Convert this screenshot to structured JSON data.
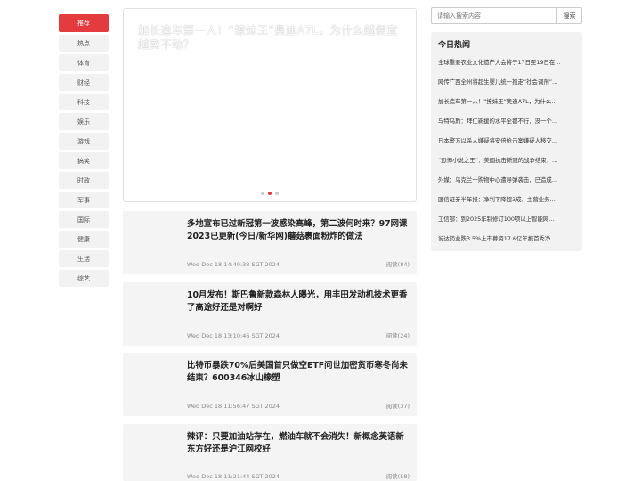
{
  "nav": {
    "items": [
      "推荐",
      "热点",
      "体育",
      "财经",
      "科技",
      "娱乐",
      "游戏",
      "搞笑",
      "时政",
      "军事",
      "国际",
      "健康",
      "生活",
      "综艺"
    ]
  },
  "carousel": {
    "caption": "加长造车第一人！“撩妹王”奥迪A7L，为什么越便宜越卖不动？",
    "active_slide": 2,
    "slide_count": 3
  },
  "articles": [
    {
      "title": "多地宣布已过新冠第一波感染高峰，第二波何时来？97网课2023已更新(今日/新华网)蘑菇裹面粉炸的做法",
      "date": "Wed Dec 18 14:49:38 SGT 2024",
      "reads": "阅读(84)"
    },
    {
      "title": "10月发布！斯巴鲁新款森林人曝光，用丰田发动机技术更香了高途好还是对啊好",
      "date": "Wed Dec 18 13:10:46 SGT 2024",
      "reads": "阅读(24)"
    },
    {
      "title": "比特币暴跌70%后美国首只做空ETF问世加密货币寒冬尚未结束？600346冰山橡塑",
      "date": "Wed Dec 18 11:56:47 SGT 2024",
      "reads": "阅读(37)"
    },
    {
      "title": "辣评：只要加油站存在，燃油车就不会消失！新概念英语新东方好还是沪江网校好",
      "date": "Wed Dec 18 11:21:44 SGT 2024",
      "reads": "阅读(58)"
    }
  ],
  "search": {
    "placeholder": "请输入搜索内容",
    "value": "",
    "button_label": "搜索"
  },
  "hot": {
    "title": "今日热闻",
    "items": [
      "全球重要农业文化遗产大会将于17日至19日在…",
      "网传广西全州将超生婴儿统一抱走“社会调剂”…",
      "加长造车第一人！“撩妹王”奥迪A7L，为什么…",
      "马特乌斯：拜仁新援的水平全都不行，没一个…",
      "日本警方以杀人嫌疑将安倍枪击案嫌疑人移交…",
      "“恐怖小说之王”：美国抗击新冠的战争结束，…",
      "外媒：乌克兰一购物中心遭导弹袭击，已造成…",
      "国信证券半年报：净利下降超3成，主营业务…",
      "工信部：到2025年制修订100项以上智能网…",
      "诚达药业跌3.5%上市募资17.6亿年报首秀净…"
    ]
  },
  "colors": {
    "accent": "#e33b3e",
    "card_bg": "#f4f4f4",
    "panel_bg": "#f2f2f2"
  }
}
